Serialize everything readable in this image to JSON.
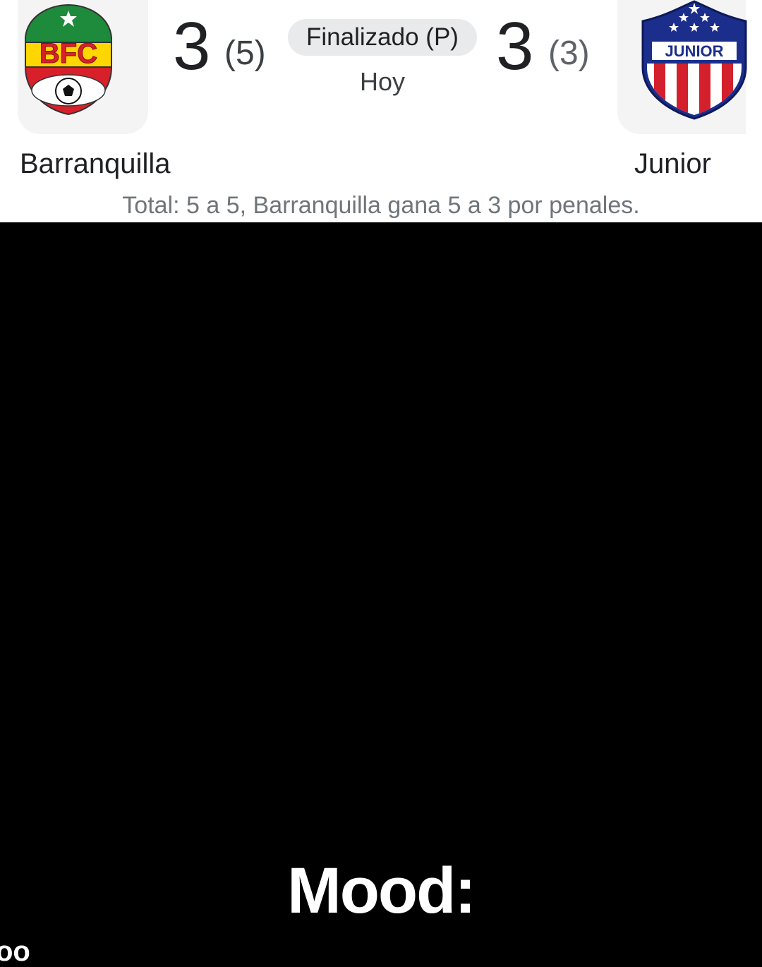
{
  "match": {
    "home": {
      "name": "Barranquilla",
      "score": "3",
      "penalties": "(5)",
      "crest_text": "BFC",
      "crest_icon": "barranquilla-fc-crest"
    },
    "away": {
      "name": "Junior",
      "score": "3",
      "penalties": "(3)",
      "crest_text": "JUNIOR",
      "crest_icon": "junior-crest"
    },
    "status": "Finalizado (P)",
    "date": "Hoy",
    "summary": "Total: 5 a 5, Barranquilla gana 5 a 3 por penales."
  },
  "caption": "Mood:",
  "corner_fragment": "oo",
  "colors": {
    "background": "#000000",
    "card": "#ffffff",
    "pill": "#e9eaeb",
    "text_dark": "#202124",
    "text_muted": "#70757a",
    "bfc_green": "#1e8a3c",
    "bfc_yellow": "#ffd600",
    "bfc_red": "#d8202a",
    "junior_red": "#d3202c",
    "junior_blue": "#1b2e8c"
  }
}
